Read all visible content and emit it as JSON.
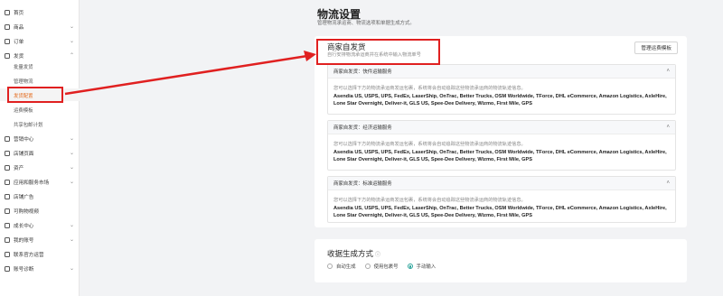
{
  "sidebar": {
    "items": [
      {
        "label": "首页",
        "chevron": ""
      },
      {
        "label": "商品",
        "chevron": "⌄"
      },
      {
        "label": "订单",
        "chevron": "⌄"
      },
      {
        "label": "发货",
        "chevron": "⌃"
      }
    ],
    "sub_items": [
      {
        "label": "批量发货"
      },
      {
        "label": "管理物流"
      },
      {
        "label": "发货配置",
        "active": true
      },
      {
        "label": "运费模板"
      },
      {
        "label": "共享包邮计划"
      }
    ],
    "items_after": [
      {
        "label": "营销中心",
        "chevron": "⌄"
      },
      {
        "label": "店铺页面",
        "chevron": "⌄"
      },
      {
        "label": "资产",
        "chevron": "⌄"
      },
      {
        "label": "应用和服务市场",
        "chevron": "⌄"
      },
      {
        "label": "店铺广告",
        "chevron": ""
      },
      {
        "label": "可购物视频",
        "chevron": ""
      },
      {
        "label": "成长中心",
        "chevron": "⌄"
      },
      {
        "label": "我的账号",
        "chevron": "⌄"
      },
      {
        "label": "联系官方运营",
        "chevron": ""
      },
      {
        "label": "账号诊断",
        "chevron": "⌄"
      }
    ]
  },
  "page": {
    "title": "物流设置",
    "desc": "管理物流承运商、物流选项和单据生成方式。"
  },
  "self_ship": {
    "title": "商家自发货",
    "subtitle": "自行安排物流承运商并在系统中输入物流单号",
    "template_button": "管理运费模板",
    "services": [
      {
        "name": "商家自发货：快件运输服务",
        "note": "您可以选择下方的物流承运商发运包裹，系统将会自动追踪这些物流承运商的物流轨迹信息。",
        "carriers": "Asendia US, USPS, UPS, FedEx, LaserShip, OnTrac, Better Trucks, OSM Worldwide, TForce, DHL eCommerce, Amazon Logistics, AxleHire, Lone Star Overnight, Deliver-it, GLS US, Spee-Dee Delivery, Wizmo, First Mile, GPS"
      },
      {
        "name": "商家自发货：经济运输服务",
        "note": "您可以选择下方的物流承运商发运包裹，系统将会自动追踪这些物流承运商的物流轨迹信息。",
        "carriers": "Asendia US, USPS, UPS, FedEx, LaserShip, OnTrac, Better Trucks, OSM Worldwide, TForce, DHL eCommerce, Amazon Logistics, AxleHire, Lone Star Overnight, Deliver-it, GLS US, Spee-Dee Delivery, Wizmo, First Mile, GPS"
      },
      {
        "name": "商家自发货：标准运输服务",
        "note": "您可以选择下方的物流承运商发运包裹，系统将会自动追踪这些物流承运商的物流轨迹信息。",
        "carriers": "Asendia US, USPS, UPS, FedEx, LaserShip, OnTrac, Better Trucks, OSM Worldwide, TForce, DHL eCommerce, Amazon Logistics, AxleHire, Lone Star Overnight, Deliver-it, GLS US, Spee-Dee Delivery, Wizmo, First Mile, GPS"
      }
    ]
  },
  "label_method": {
    "title": "收据生成方式",
    "help": "ⓘ",
    "options": [
      {
        "label": "自动生成",
        "selected": false
      },
      {
        "label": "使用包裹号",
        "selected": false
      },
      {
        "label": "手动输入",
        "selected": true
      }
    ]
  },
  "colors": {
    "annotation": "#e02020",
    "accent": "#2aa39a",
    "active_nav": "#e36a1b"
  },
  "icons": {
    "collapse": "chevron-up-icon",
    "expand": "chevron-down-icon"
  }
}
